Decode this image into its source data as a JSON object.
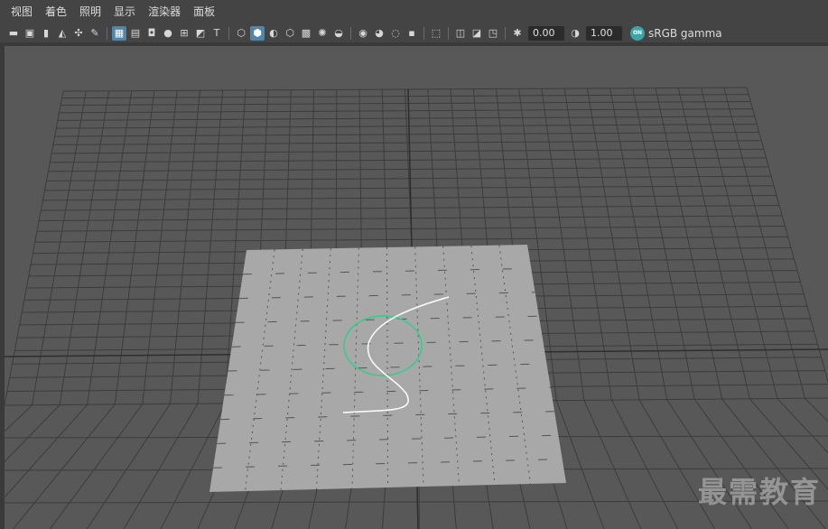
{
  "menu": {
    "items": [
      "视图",
      "着色",
      "照明",
      "显示",
      "渲染器",
      "面板"
    ]
  },
  "toolbar": {
    "exposure_value": "0.00",
    "gamma_value": "1.00",
    "color_space_label": "sRGB gamma",
    "color_mgmt_toggle": "ON"
  },
  "watermark": {
    "text": "最需教育"
  },
  "colors": {
    "viewport_bg": "#585858",
    "plane_fill": "#a8a8a8",
    "grid_line": "#3c3c3c",
    "circle": "#2ecf8a",
    "curve": "#ffffff",
    "active_button": "#5285a6"
  }
}
